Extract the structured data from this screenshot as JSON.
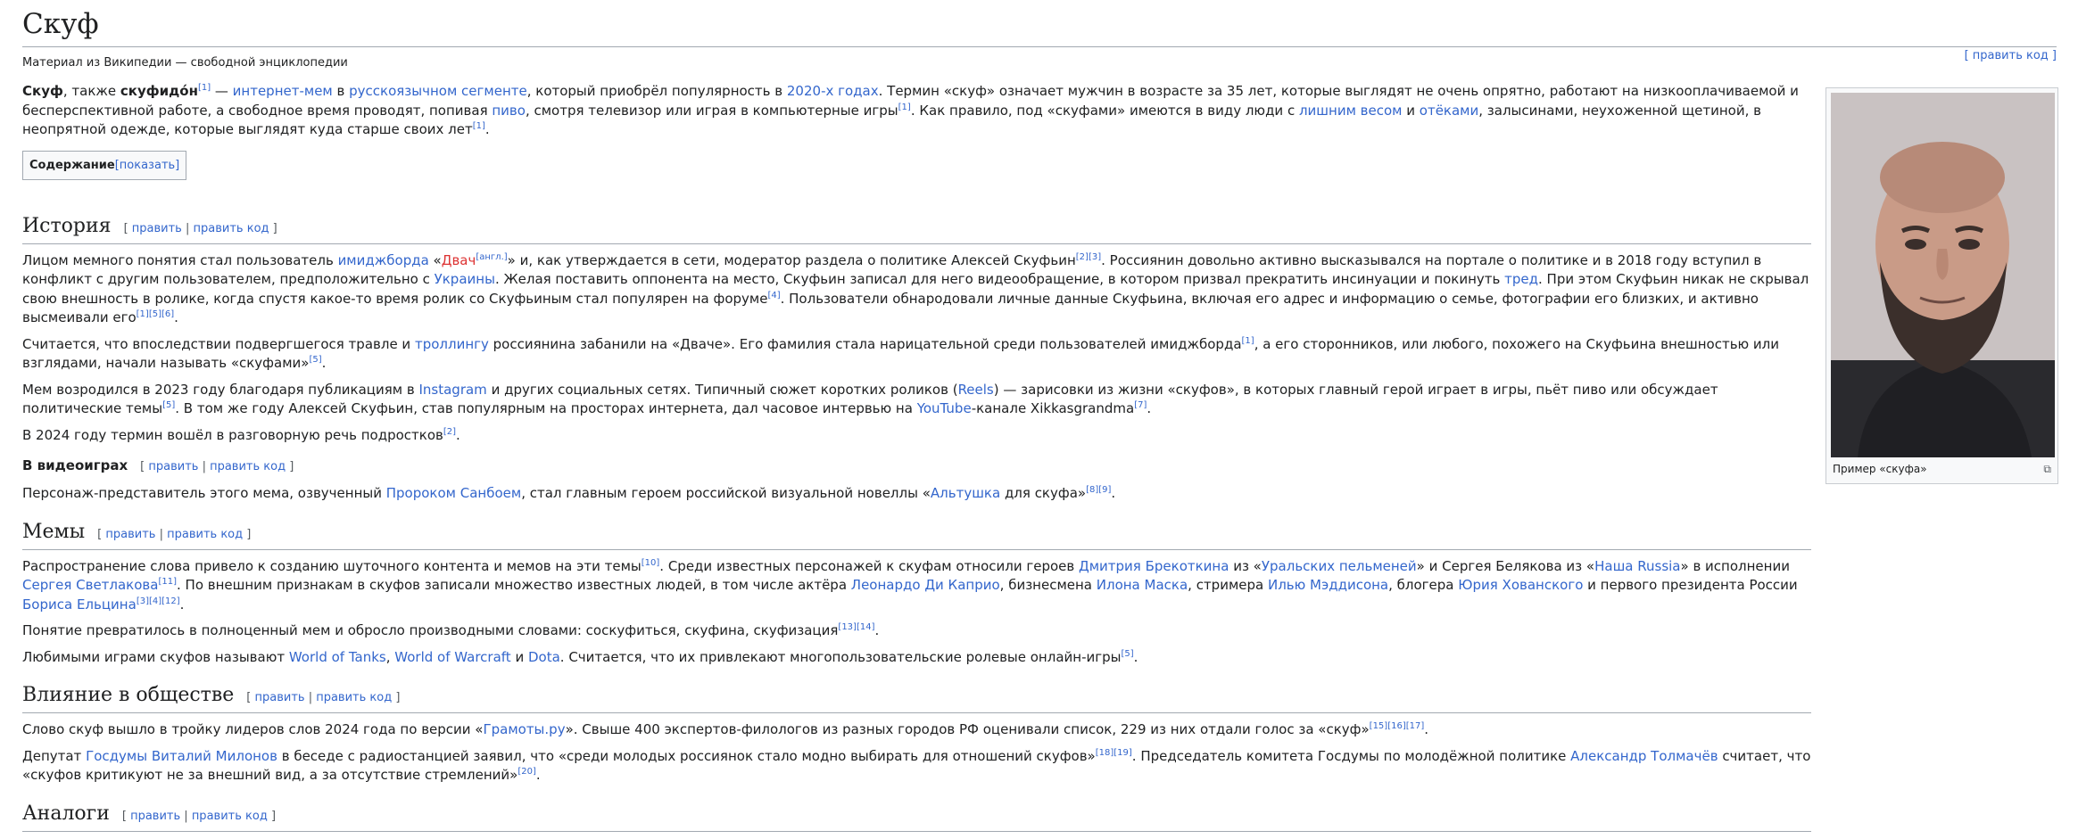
{
  "title": "Скуф",
  "tagline": "Материал из Википедии — свободной энциклопедии",
  "edit_code_top": "[ править код ]",
  "intro": {
    "b1": "Скуф",
    "t1": ", также ",
    "b2": "скуфидо́н",
    "s1": "[1]",
    "t2": " — ",
    "l1": "интернет-мем",
    "t3": " в ",
    "l2": "русскоязычном сегменте",
    "t4": ", который приобрёл популярность в ",
    "l3": "2020-х годах",
    "t5": ". Термин «скуф» означает мужчин в возрасте за 35 лет, которые выглядят не очень опрятно, работают на низкооплачиваемой и бесперспективной работе, а свободное время проводят, попивая ",
    "l4": "пиво",
    "t6": ", смотря телевизор или играя в компьютерные игры",
    "s2": "[1]",
    "t7": ". Как правило, под «скуфами» имеются в виду люди с ",
    "l5": "лишним весом",
    "t8": " и ",
    "l6": "отёками",
    "t9": ", залысинами, неухоженной щетиной, в неопрятной одежде, которые выглядят куда старше своих лет",
    "s3": "[1]",
    "t10": "."
  },
  "toc": {
    "label": "Содержание",
    "show": "[показать]"
  },
  "edit": {
    "open": "[",
    "edit": "править",
    "sep": "|",
    "code": "править код",
    "close": "]"
  },
  "history": {
    "heading": "История",
    "p1": {
      "t1": "Лицом мемного понятия стал пользователь ",
      "l1": "имиджборда",
      "t2": " «",
      "r1": "Двач",
      "s1": "[англ.]",
      "t3": "» и, как утверждается в сети, модератор раздела о политике Алексей Скуфьин",
      "s2": "[2][3]",
      "t4": ". Россиянин довольно активно высказывался на портале о политике и в 2018 году вступил в конфликт с другим пользователем, предположительно с ",
      "l2": "Украины",
      "t5": ". Желая поставить оппонента на место, Скуфьин записал для него видеообращение, в котором призвал прекратить инсинуации и покинуть ",
      "l3": "тред",
      "t6": ". При этом Скуфьин никак не скрывал свою внешность в ролике, когда спустя какое-то время ролик со Скуфьиным стал популярен на форуме",
      "s3": "[4]",
      "t7": ". Пользователи обнародовали личные данные Скуфьина, включая его адрес и информацию о семье, фотографии его близких, и активно высмеивали его",
      "s4": "[1][5][6]",
      "t8": "."
    },
    "p2": {
      "t1": "Считается, что впоследствии подвергшегося травле и ",
      "l1": "троллингу",
      "t2": " россиянина забанили на «Дваче». Его фамилия стала нарицательной среди пользователей имиджборда",
      "s1": "[1]",
      "t3": ", а его сторонников, или любого, похожего на Скуфьина внешностью или взглядами, начали называть «скуфами»",
      "s2": "[5]",
      "t4": "."
    },
    "p3": {
      "t1": "Мем возродился в 2023 году благодаря публикациям в ",
      "l1": "Instagram",
      "t2": " и других социальных сетях. Типичный сюжет коротких роликов (",
      "l2": "Reels",
      "t3": ") — зарисовки из жизни «скуфов», в которых главный герой играет в игры, пьёт пиво или обсуждает политические темы",
      "s1": "[5]",
      "t4": ". В том же году Алексей Скуфьин, став популярным на просторах интернета, дал часовое интервью на ",
      "l3": "YouTube",
      "t5": "-канале Xikkasgrandma",
      "s2": "[7]",
      "t6": "."
    },
    "p4": {
      "t1": "В 2024 году термин вошёл в разговорную речь подростков",
      "s1": "[2]",
      "t2": "."
    }
  },
  "videogames": {
    "heading": "В видеоиграх",
    "p1": {
      "t1": "Персонаж-представитель этого мема, озвученный ",
      "l1": "Пророком Санбоем",
      "t2": ", стал главным героем российской визуальной новеллы «",
      "l2": "Альтушка",
      "t3": " для скуфа»",
      "s1": "[8][9]",
      "t4": "."
    }
  },
  "memes": {
    "heading": "Мемы",
    "p1": {
      "t1": "Распространение слова привело к созданию шуточного контента и мемов на эти темы",
      "s1": "[10]",
      "t2": ". Среди известных персонажей к скуфам относили героев ",
      "l1": "Дмитрия Брекоткина",
      "t3": " из «",
      "l2": "Уральских пельменей",
      "t4": "» и Сергея Белякова из «",
      "l3": "Наша Russia",
      "t5": "» в исполнении ",
      "l4": "Сергея Светлакова",
      "s2": "[11]",
      "t6": ". По внешним признакам в скуфов записали множество известных людей, в том числе актёра ",
      "l5": "Леонардо Ди Каприо",
      "t7": ", бизнесмена ",
      "l6": "Илона Маска",
      "t8": ", стримера ",
      "l7": "Илью Мэддисона",
      "t9": ", блогера ",
      "l8": "Юрия Хованского",
      "t10": " и первого президента России ",
      "l9": "Бориса Ельцина",
      "s3": "[3][4][12]",
      "t11": "."
    },
    "p2": {
      "t1": "Понятие превратилось в полноценный мем и обросло производными словами: соскуфиться, скуфина, скуфизация",
      "s1": "[13][14]",
      "t2": "."
    },
    "p3": {
      "t1": "Любимыми играми скуфов называют ",
      "l1": "World of Tanks",
      "t2": ", ",
      "l2": "World of Warcraft",
      "t3": " и ",
      "l3": "Dota",
      "t4": ". Считается, что их привлекают многопользовательские ролевые онлайн-игры",
      "s1": "[5]",
      "t5": "."
    }
  },
  "influence": {
    "heading": "Влияние в обществе",
    "p1": {
      "t1": "Слово скуф вышло в тройку лидеров слов 2024 года по версии «",
      "l1": "Грамоты.ру",
      "t2": "». Свыше 400 экспертов-филологов из разных городов РФ оценивали список, 229 из них отдали голос за «скуф»",
      "s1": "[15][16][17]",
      "t3": "."
    },
    "p2": {
      "t1": "Депутат ",
      "l1": "Госдумы",
      "t2": " ",
      "l2": "Виталий Милонов",
      "t3": " в беседе с радиостанцией заявил, что «среди молодых россиянок стало модно выбирать для отношений скуфов»",
      "s1": "[18][19]",
      "t4": ". Председатель комитета Госдумы по молодёжной политике ",
      "l3": "Александр Толмачёв",
      "t5": " считает, что «скуфов критикуют не за внешний вид, а за отсутствие стремлений»",
      "s2": "[20]",
      "t6": "."
    }
  },
  "analogs": {
    "heading": "Аналоги"
  },
  "infobox": {
    "caption": "Пример «скуфа»",
    "enlarge_icon": "enlarge-icon"
  }
}
